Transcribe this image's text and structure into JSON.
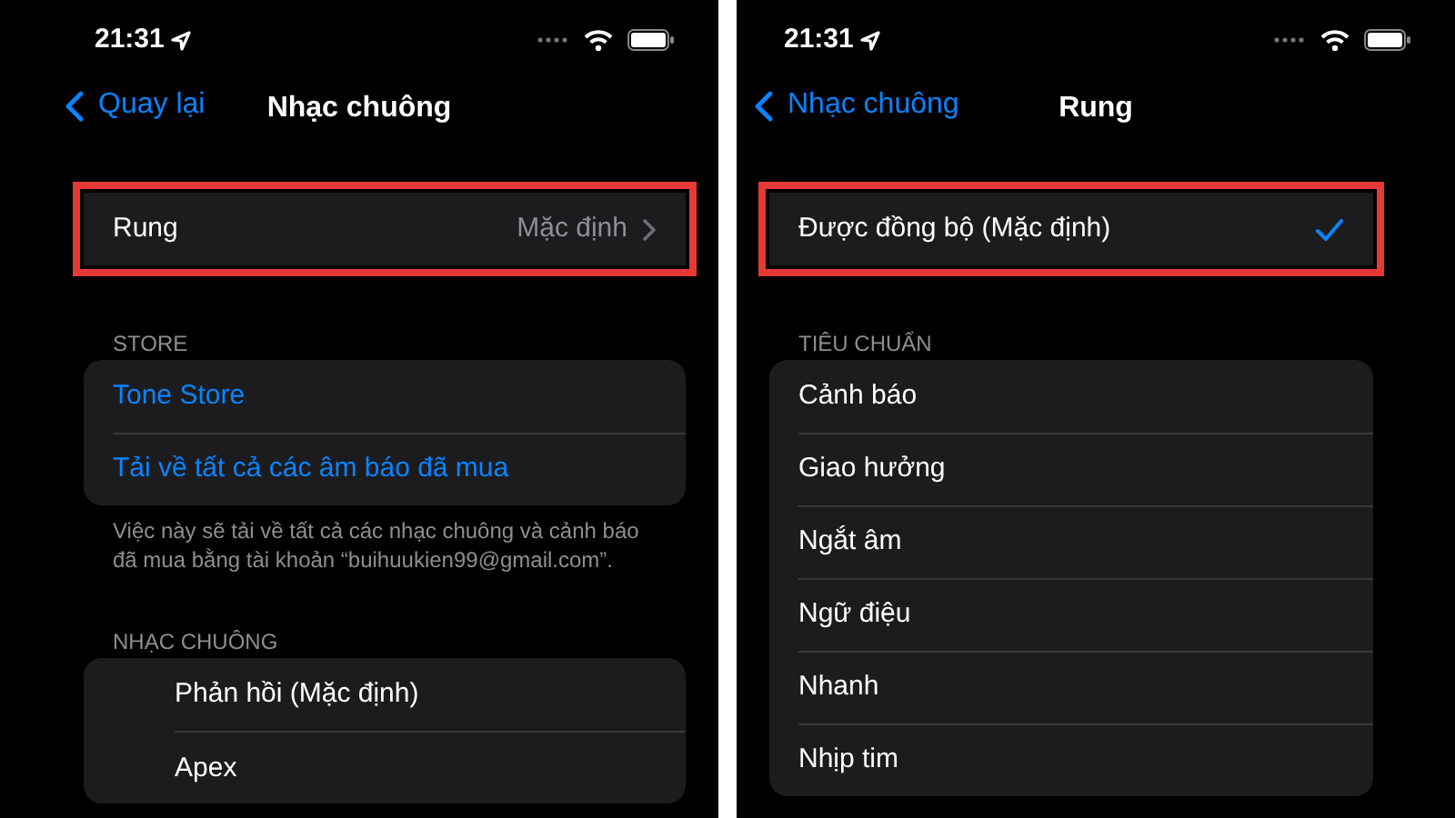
{
  "screens": [
    {
      "status_bar": {
        "time": "21:31"
      },
      "nav": {
        "back": "Quay lại",
        "title": "Nhạc chuông"
      },
      "sections": [
        {
          "highlighted": true,
          "rows": [
            {
              "kind": "detail",
              "label": "Rung",
              "value": "Mặc định"
            }
          ]
        },
        {
          "highlighted": false,
          "header": "STORE",
          "rows": [
            {
              "kind": "link",
              "label": "Tone Store"
            },
            {
              "kind": "link",
              "label": "Tải về tất cả các âm báo đã mua"
            }
          ],
          "footer": "Việc này sẽ tải về tất cả các nhạc chuông và cảnh báo đã mua bằng tài khoản “buihuukien99@gmail.com”."
        },
        {
          "highlighted": false,
          "header": "NHẠC CHUÔNG",
          "rows": [
            {
              "kind": "tone",
              "label": "Phản hồi (Mặc định)"
            },
            {
              "kind": "tone",
              "label": "Apex"
            }
          ]
        }
      ]
    },
    {
      "status_bar": {
        "time": "21:31"
      },
      "nav": {
        "back": "Nhạc chuông",
        "title": "Rung"
      },
      "sections": [
        {
          "highlighted": true,
          "rows": [
            {
              "kind": "option",
              "label": "Được đồng bộ (Mặc định)",
              "checked": true
            }
          ]
        },
        {
          "highlighted": false,
          "header": "TIÊU CHUẨN",
          "rows": [
            {
              "kind": "option",
              "label": "Cảnh báo",
              "checked": false
            },
            {
              "kind": "option",
              "label": "Giao hưởng",
              "checked": false
            },
            {
              "kind": "option",
              "label": "Ngắt âm",
              "checked": false
            },
            {
              "kind": "option",
              "label": "Ngữ điệu",
              "checked": false
            },
            {
              "kind": "option",
              "label": "Nhanh",
              "checked": false
            },
            {
              "kind": "option",
              "label": "Nhịp tim",
              "checked": false
            }
          ]
        }
      ]
    }
  ]
}
